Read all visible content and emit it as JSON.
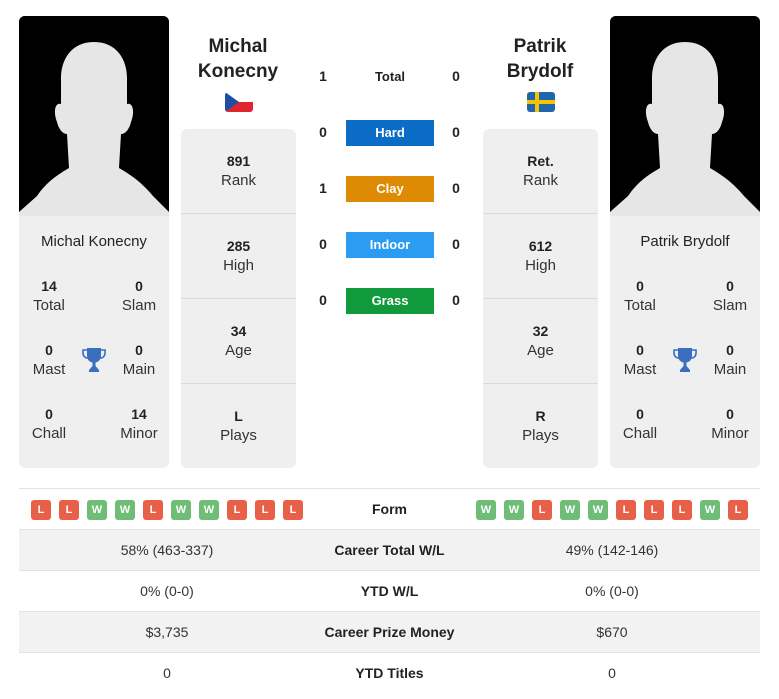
{
  "players": {
    "left": {
      "name_line1": "Michal",
      "name_line2": "Konecny",
      "full_name": "Michal Konecny",
      "country": "Czech Republic",
      "flag_icon": "czech-flag-icon",
      "titles": {
        "total": {
          "value": "14",
          "label": "Total"
        },
        "slam": {
          "value": "0",
          "label": "Slam"
        },
        "mast": {
          "value": "0",
          "label": "Mast"
        },
        "main": {
          "value": "0",
          "label": "Main"
        },
        "chall": {
          "value": "0",
          "label": "Chall"
        },
        "minor": {
          "value": "14",
          "label": "Minor"
        }
      },
      "ranks": [
        {
          "value": "891",
          "label": "Rank"
        },
        {
          "value": "285",
          "label": "High"
        },
        {
          "value": "34",
          "label": "Age"
        },
        {
          "value": "L",
          "label": "Plays"
        }
      ],
      "form": [
        "L",
        "L",
        "W",
        "W",
        "L",
        "W",
        "W",
        "L",
        "L",
        "L"
      ]
    },
    "right": {
      "name_line1": "Patrik",
      "name_line2": "Brydolf",
      "full_name": "Patrik Brydolf",
      "country": "Sweden",
      "flag_icon": "sweden-flag-icon",
      "titles": {
        "total": {
          "value": "0",
          "label": "Total"
        },
        "slam": {
          "value": "0",
          "label": "Slam"
        },
        "mast": {
          "value": "0",
          "label": "Mast"
        },
        "main": {
          "value": "0",
          "label": "Main"
        },
        "chall": {
          "value": "0",
          "label": "Chall"
        },
        "minor": {
          "value": "0",
          "label": "Minor"
        }
      },
      "ranks": [
        {
          "value": "Ret.",
          "label": "Rank"
        },
        {
          "value": "612",
          "label": "High"
        },
        {
          "value": "32",
          "label": "Age"
        },
        {
          "value": "R",
          "label": "Plays"
        }
      ],
      "form": [
        "W",
        "W",
        "L",
        "W",
        "W",
        "L",
        "L",
        "L",
        "W",
        "L"
      ]
    }
  },
  "h2h": [
    {
      "label": "Total",
      "left": "1",
      "right": "0",
      "color": ""
    },
    {
      "label": "Hard",
      "left": "0",
      "right": "0",
      "color": "#0a6cc4"
    },
    {
      "label": "Clay",
      "left": "1",
      "right": "0",
      "color": "#dd8a05"
    },
    {
      "label": "Indoor",
      "left": "0",
      "right": "0",
      "color": "#2b9cf2"
    },
    {
      "label": "Grass",
      "left": "0",
      "right": "0",
      "color": "#119a3c"
    }
  ],
  "stats_table": {
    "form_label": "Form",
    "rows": [
      {
        "label": "Career Total W/L",
        "left": "58% (463-337)",
        "right": "49% (142-146)"
      },
      {
        "label": "YTD W/L",
        "left": "0% (0-0)",
        "right": "0% (0-0)"
      },
      {
        "label": "Career Prize Money",
        "left": "$3,735",
        "right": "$670"
      },
      {
        "label": "YTD Titles",
        "left": "0",
        "right": "0"
      }
    ]
  },
  "colors": {
    "win": "#6fbd76",
    "loss": "#e9604a",
    "trophy": "#3a6fc0"
  }
}
